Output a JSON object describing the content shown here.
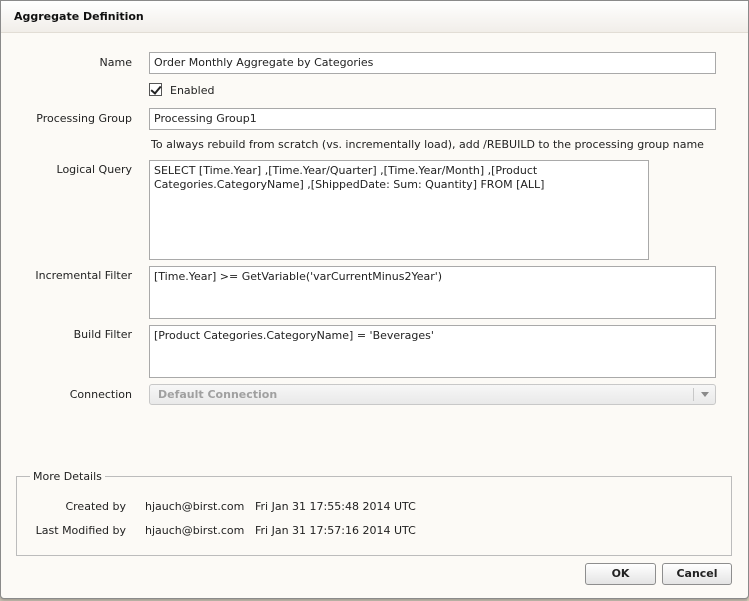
{
  "window": {
    "title": "Aggregate Definition"
  },
  "form": {
    "name_label": "Name",
    "name_value": "Order Monthly Aggregate by Categories",
    "enabled_label": "Enabled",
    "enabled_checked": true,
    "processing_group_label": "Processing Group",
    "processing_group_value": "Processing Group1",
    "processing_group_hint": "To always rebuild from scratch (vs. incrementally load), add /REBUILD to the processing group name",
    "logical_query_label": "Logical Query",
    "logical_query_value": "SELECT [Time.Year] ,[Time.Year/Quarter] ,[Time.Year/Month] ,[Product Categories.CategoryName] ,[ShippedDate: Sum: Quantity] FROM [ALL]",
    "incremental_filter_label": "Incremental Filter",
    "incremental_filter_value": "[Time.Year] >= GetVariable('varCurrentMinus2Year')",
    "build_filter_label": "Build Filter",
    "build_filter_value": "[Product Categories.CategoryName] = 'Beverages'",
    "connection_label": "Connection",
    "connection_value": "Default Connection"
  },
  "details": {
    "legend": "More Details",
    "created_by_label": "Created by",
    "created_by_user": "hjauch@birst.com",
    "created_by_date": "Fri Jan 31 17:55:48 2014 UTC",
    "modified_by_label": "Last Modified by",
    "modified_by_user": "hjauch@birst.com",
    "modified_by_date": "Fri Jan 31 17:57:16 2014 UTC"
  },
  "buttons": {
    "ok": "OK",
    "cancel": "Cancel"
  }
}
